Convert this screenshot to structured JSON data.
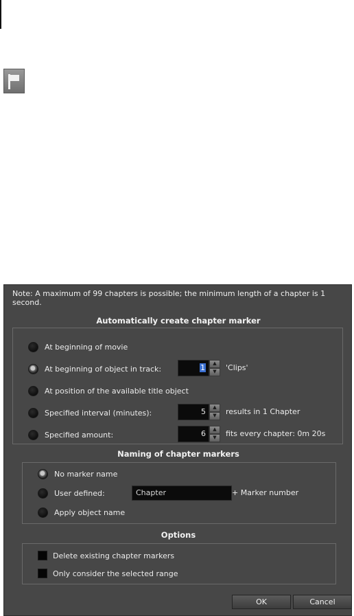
{
  "note": "Note: A maximum of 99 chapters is possible; the minimum length of a chapter is 1 second.",
  "auto_section": {
    "title": "Automatically create chapter marker",
    "options": [
      {
        "label": "At beginning of movie",
        "checked": false
      },
      {
        "label": "At beginning of object in track:",
        "checked": true
      },
      {
        "label": "At position of the available title object",
        "checked": false
      },
      {
        "label": "Specified interval (minutes):",
        "checked": false
      },
      {
        "label": "Specified amount:",
        "checked": false
      }
    ],
    "track_spin": {
      "value": "1",
      "suffix": "'Clips'"
    },
    "interval_spin": {
      "value": "5",
      "suffix": "results in 1 Chapter"
    },
    "amount_spin": {
      "value": "6",
      "suffix": "fits every chapter: 0m 20s"
    }
  },
  "naming_section": {
    "title": "Naming of chapter markers",
    "options": [
      {
        "label": "No marker name",
        "checked": true
      },
      {
        "label": "User defined:",
        "checked": false
      },
      {
        "label": "Apply object name",
        "checked": false
      }
    ],
    "user_defined_value": "Chapter",
    "marker_suffix": "+ Marker number"
  },
  "options_section": {
    "title": "Options",
    "items": [
      {
        "label": "Delete existing chapter markers",
        "checked": false
      },
      {
        "label": "Only consider the selected range",
        "checked": false
      }
    ]
  },
  "buttons": {
    "ok": "OK",
    "cancel": "Cancel"
  }
}
